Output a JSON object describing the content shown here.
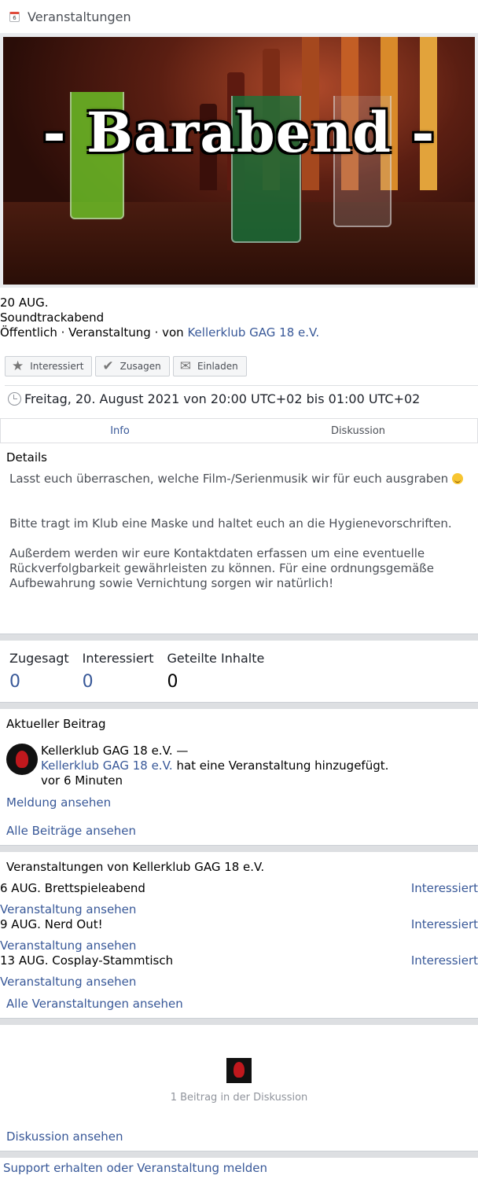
{
  "header": {
    "icon_text": "6",
    "title": "Veranstaltungen"
  },
  "cover": {
    "banner_text": "- Barabend -"
  },
  "event": {
    "date": "20 AUG.",
    "title": "Soundtrackabend",
    "meta_prefix": "Öffentlich · Veranstaltung · von ",
    "organizer": "Kellerklub GAG 18 e.V.",
    "time": "Freitag, 20. August 2021 von 20:00 UTC+02 bis 01:00 UTC+02"
  },
  "actions": {
    "interested": "Interessiert",
    "going": "Zusagen",
    "invite": "Einladen"
  },
  "tabs": {
    "info": "Info",
    "discussion": "Diskussion"
  },
  "details": {
    "heading": "Details",
    "p1": "Lasst euch überraschen, welche Film-/Serienmusik wir für euch ausgraben",
    "p2": "Bitte tragt im Klub eine Maske und haltet euch an die Hygienevorschriften.",
    "p3": "Außerdem werden wir eure Kontaktdaten erfassen um eine eventuelle Rückverfolgbarkeit gewährleisten zu können. Für eine ordnungsgemäße Aufbewahrung sowie Vernichtung sorgen wir natürlich!"
  },
  "stats": {
    "going_label": "Zugesagt",
    "going_count": "0",
    "interested_label": "Interessiert",
    "interested_count": "0",
    "shared_label": "Geteilte Inhalte",
    "shared_count": "0"
  },
  "recent_post": {
    "heading": "Aktueller Beitrag",
    "author": "Kellerklub GAG 18 e.V. —",
    "author_link": "Kellerklub GAG 18 e.V.",
    "action": " hat eine Veranstaltung hinzugefügt.",
    "time": "vor 6 Minuten",
    "view_report": "Meldung ansehen",
    "view_all": "Alle Beiträge ansehen"
  },
  "more_events": {
    "heading": "Veranstaltungen von Kellerklub GAG 18 e.V.",
    "items": [
      {
        "date": "6 AUG.",
        "name": "Brettspieleabend",
        "interested": "Interessiert",
        "view": "Veranstaltung ansehen"
      },
      {
        "date": "9 AUG.",
        "name": "Nerd Out!",
        "interested": "Interessiert",
        "view": "Veranstaltung ansehen"
      },
      {
        "date": "13 AUG.",
        "name": "Cosplay-Stammtisch",
        "interested": "Interessiert",
        "view": "Veranstaltung ansehen"
      }
    ],
    "view_all": "Alle Veranstaltungen ansehen"
  },
  "discussion": {
    "count_text": "1 Beitrag in der Diskussion",
    "view": "Diskussion ansehen"
  },
  "footer": {
    "support": "Support erhalten oder Veranstaltung melden"
  },
  "colors": {
    "link": "#385898",
    "separator": "#dddfe2"
  }
}
